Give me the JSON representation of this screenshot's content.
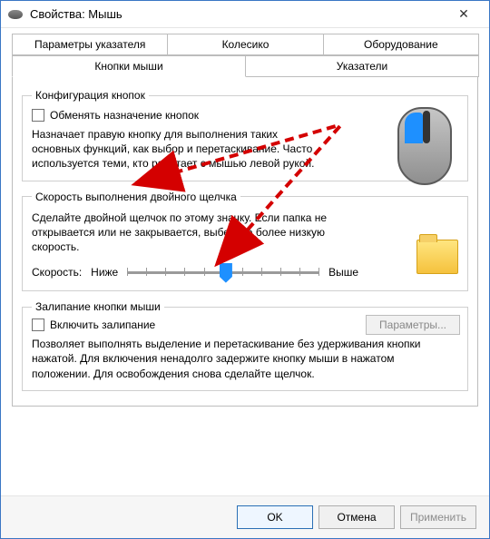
{
  "window": {
    "title": "Свойства: Мышь"
  },
  "tabs": {
    "row1": [
      {
        "label": "Параметры указателя"
      },
      {
        "label": "Колесико"
      },
      {
        "label": "Оборудование"
      }
    ],
    "row2": [
      {
        "label": "Кнопки мыши",
        "active": true
      },
      {
        "label": "Указатели"
      }
    ]
  },
  "group_buttons": {
    "legend": "Конфигурация кнопок",
    "swap_label": "Обменять назначение кнопок",
    "swap_checked": false,
    "description": "Назначает правую кнопку для выполнения таких основных функций, как выбор и перетаскивание. Часто используется теми, кто работает с мышью левой рукой."
  },
  "group_doubleclick": {
    "legend": "Скорость выполнения двойного щелчка",
    "description": "Сделайте двойной щелчок по этому значку. Если папка не открывается или не закрывается, выберите более низкую скорость.",
    "speed_label": "Скорость:",
    "lower_label": "Ниже",
    "higher_label": "Выше",
    "slider_value": 5,
    "slider_min": 0,
    "slider_max": 10
  },
  "group_clicklock": {
    "legend": "Залипание кнопки мыши",
    "enable_label": "Включить залипание",
    "enable_checked": false,
    "params_button": "Параметры...",
    "params_enabled": false,
    "description": "Позволяет выполнять выделение и перетаскивание без удерживания кнопки нажатой. Для включения ненадолго задержите кнопку мыши в нажатом положении. Для освобождения снова сделайте щелчок."
  },
  "footer": {
    "ok": "OK",
    "cancel": "Отмена",
    "apply": "Применить",
    "apply_enabled": false
  }
}
